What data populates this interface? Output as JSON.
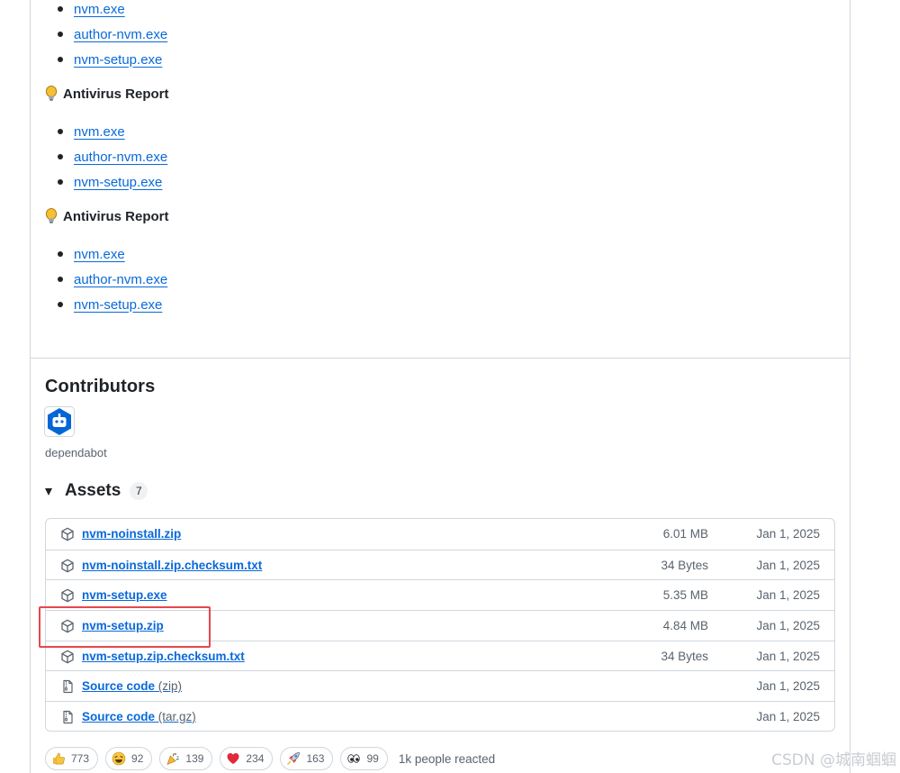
{
  "reports": [
    {
      "links": [
        "nvm.exe",
        "author-nvm.exe",
        "nvm-setup.exe"
      ]
    },
    {
      "heading": "Antivirus Report",
      "links": [
        "nvm.exe",
        "author-nvm.exe",
        "nvm-setup.exe"
      ]
    },
    {
      "heading": "Antivirus Report",
      "links": [
        "nvm.exe",
        "author-nvm.exe",
        "nvm-setup.exe"
      ]
    }
  ],
  "contributors": {
    "title": "Contributors",
    "name": "dependabot"
  },
  "assets": {
    "title": "Assets",
    "count": "7",
    "items": [
      {
        "name": "nvm-noinstall.zip",
        "suffix": "",
        "size": "6.01 MB",
        "date": "Jan 1, 2025",
        "icon": "package-icon"
      },
      {
        "name": "nvm-noinstall.zip.checksum.txt",
        "suffix": "",
        "size": "34 Bytes",
        "date": "Jan 1, 2025",
        "icon": "package-icon"
      },
      {
        "name": "nvm-setup.exe",
        "suffix": "",
        "size": "5.35 MB",
        "date": "Jan 1, 2025",
        "icon": "package-icon"
      },
      {
        "name": "nvm-setup.zip",
        "suffix": "",
        "size": "4.84 MB",
        "date": "Jan 1, 2025",
        "icon": "package-icon"
      },
      {
        "name": "nvm-setup.zip.checksum.txt",
        "suffix": "",
        "size": "34 Bytes",
        "date": "Jan 1, 2025",
        "icon": "package-icon"
      },
      {
        "name": "Source code",
        "suffix": " (zip)",
        "size": "",
        "date": "Jan 1, 2025",
        "icon": "file-zip-icon"
      },
      {
        "name": "Source code",
        "suffix": " (tar.gz)",
        "size": "",
        "date": "Jan 1, 2025",
        "icon": "file-zip-icon"
      }
    ]
  },
  "reactions": {
    "items": [
      {
        "icon": "thumbs-up-icon",
        "count": "773"
      },
      {
        "icon": "laugh-icon",
        "count": "92"
      },
      {
        "icon": "hooray-icon",
        "count": "139"
      },
      {
        "icon": "heart-icon",
        "count": "234"
      },
      {
        "icon": "rocket-icon",
        "count": "163"
      },
      {
        "icon": "eyes-icon",
        "count": "99"
      }
    ],
    "summary": "1k people reacted"
  },
  "watermark": "CSDN @城南蝈蝈",
  "colors": {
    "link": "#0969da",
    "highlight": "#e5484d",
    "border": "#d0d7de"
  }
}
